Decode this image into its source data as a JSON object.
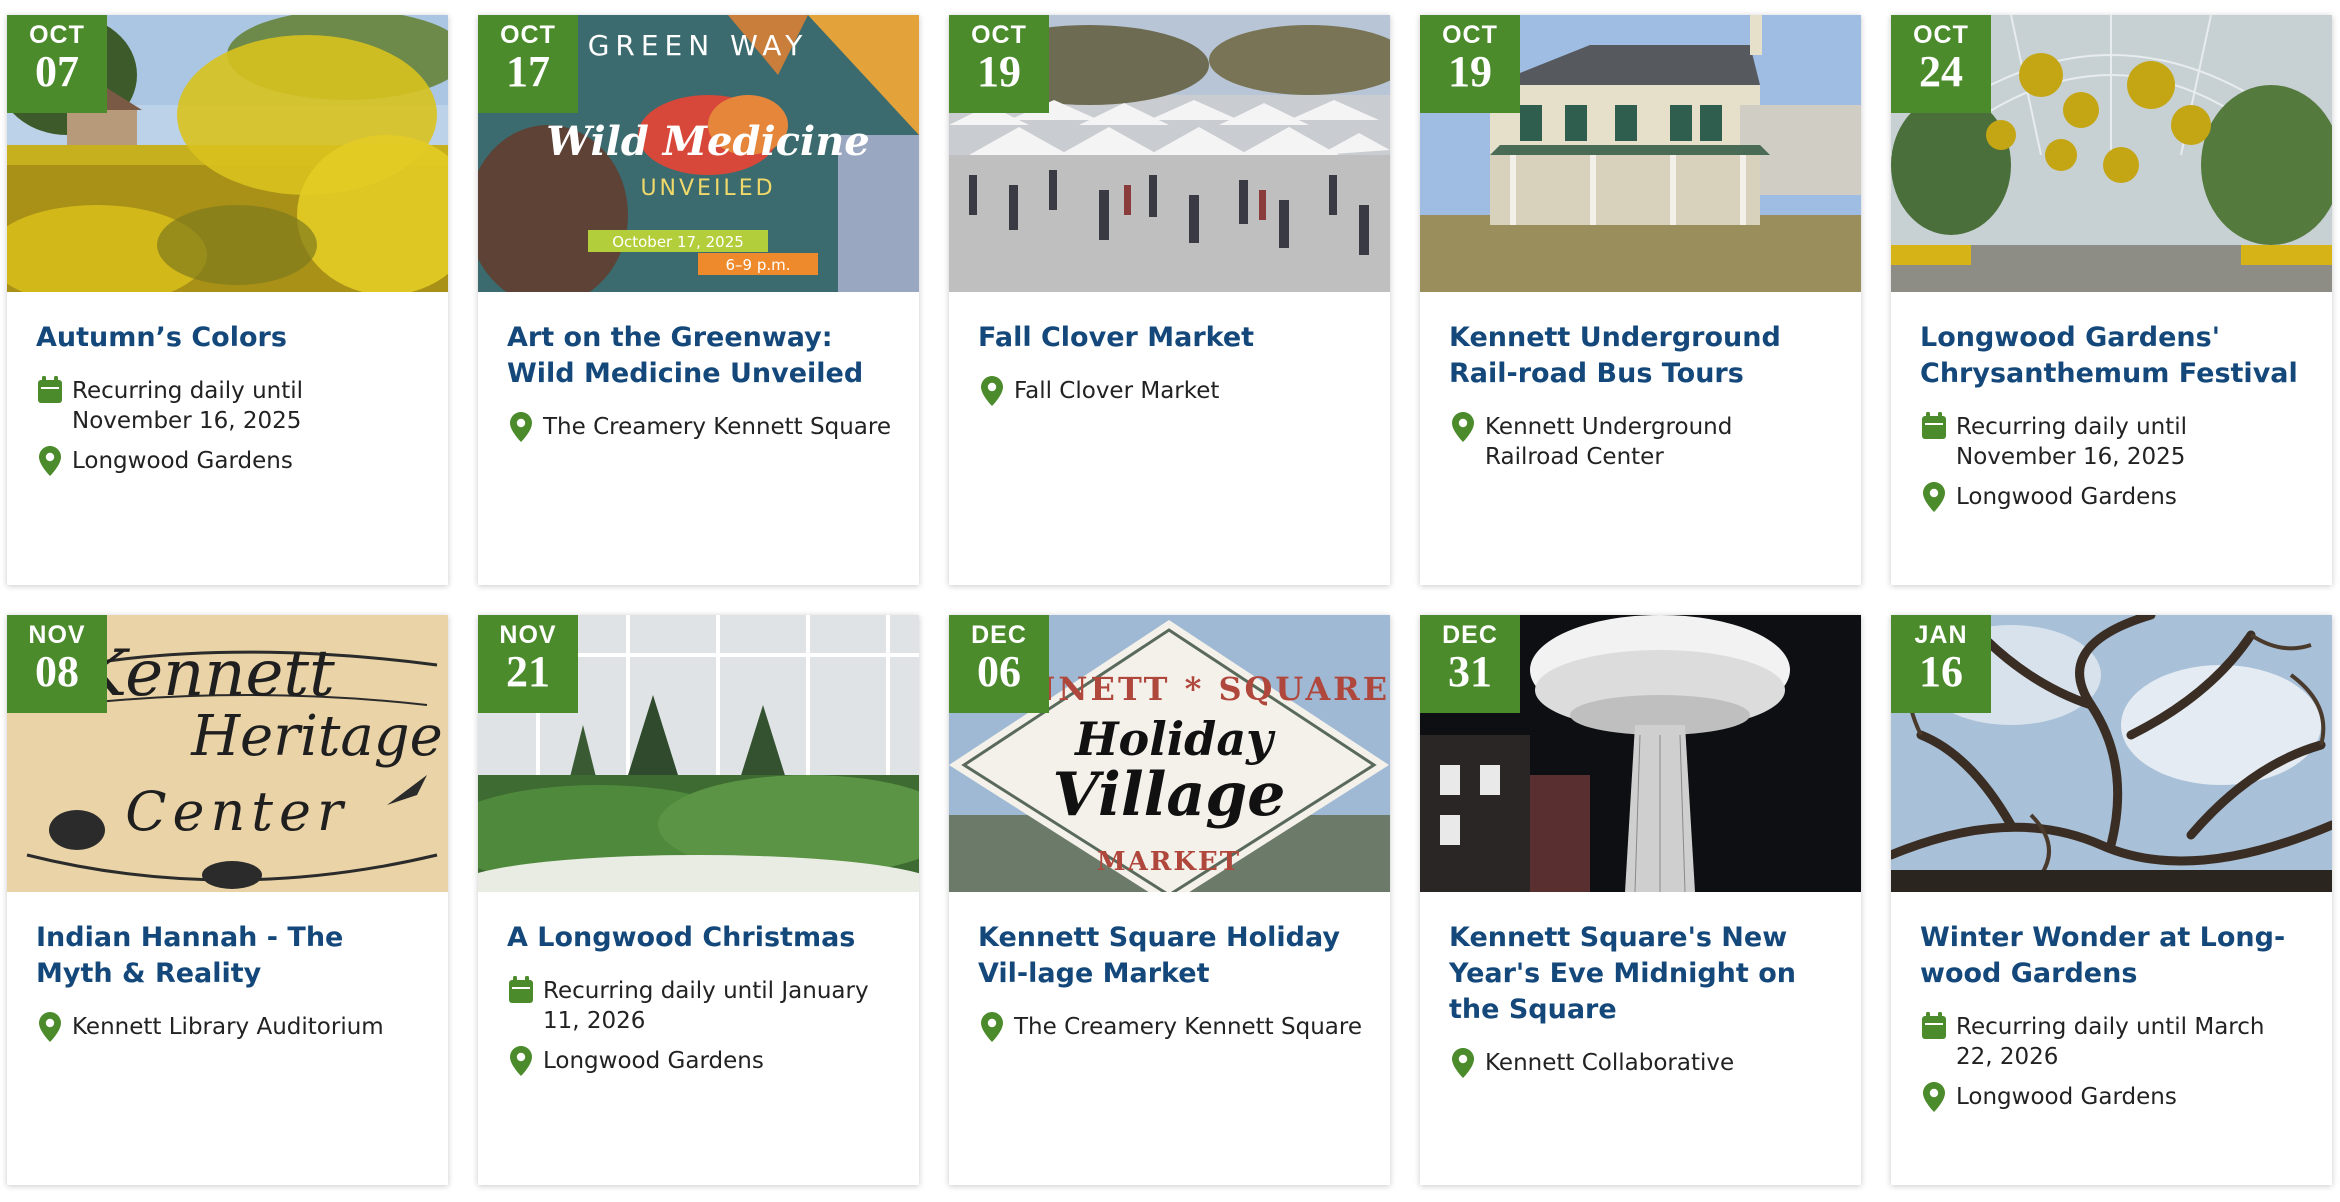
{
  "brand_colors": {
    "date_badge": "#4b8b2b",
    "title": "#14487b",
    "icon": "#4b8b2b"
  },
  "events": [
    {
      "month": "OCT",
      "day": "07",
      "title": "Autumn’s Colors",
      "recurring": "Recurring daily until November 16, 2025",
      "location": "Longwood Gardens",
      "image": "yellow-flowers-field"
    },
    {
      "month": "OCT",
      "day": "17",
      "title": "Art on the Greenway: Wild Medicine Unveiled",
      "location": "The Creamery Kennett Square",
      "image": "poster",
      "poster": {
        "top": "GREEN WAY",
        "headline": "Wild Medicine",
        "sub": "UNVEILED",
        "date": "October 17, 2025",
        "time": "6–9 p.m."
      }
    },
    {
      "month": "OCT",
      "day": "19",
      "title": "Fall Clover Market",
      "location": "Fall Clover Market",
      "image": "market-tents"
    },
    {
      "month": "OCT",
      "day": "19",
      "title": "Kennett Underground Rail-road Bus Tours",
      "location": "Kennett Underground Railroad Center",
      "image": "historic-house"
    },
    {
      "month": "OCT",
      "day": "24",
      "title": "Longwood Gardens' Chrysanthemum Festival",
      "recurring": "Recurring daily until November 16, 2025",
      "location": "Longwood Gardens",
      "image": "conservatory"
    },
    {
      "month": "NOV",
      "day": "08",
      "title": "Indian Hannah - The Myth & Reality",
      "location": "Kennett Library Auditorium",
      "image": "heritage-logo",
      "logo": {
        "line1": "Kennett",
        "line2": "Heritage",
        "line3": "Center"
      }
    },
    {
      "month": "NOV",
      "day": "21",
      "title": "A Longwood Christmas",
      "recurring": "Recurring daily until January 11, 2026",
      "location": "Longwood Gardens",
      "image": "greenhouse-trees"
    },
    {
      "month": "DEC",
      "day": "06",
      "title": "Kennett Square Holiday Vil-lage Market",
      "location": "The Creamery Kennett Square",
      "image": "holiday-sign",
      "sign": {
        "top": "KENNETT * SQUARE",
        "middle1": "Holiday",
        "middle2": "Village",
        "bottom": "MARKET"
      }
    },
    {
      "month": "DEC",
      "day": "31",
      "title": "Kennett Square's New Year's Eve Midnight on the Square",
      "location": "Kennett Collaborative",
      "image": "mushroom-lights"
    },
    {
      "month": "JAN",
      "day": "16",
      "title": "Winter Wonder at Long-wood Gardens",
      "recurring": "Recurring daily until March 22, 2026",
      "location": "Longwood Gardens",
      "image": "winter-tree"
    }
  ]
}
